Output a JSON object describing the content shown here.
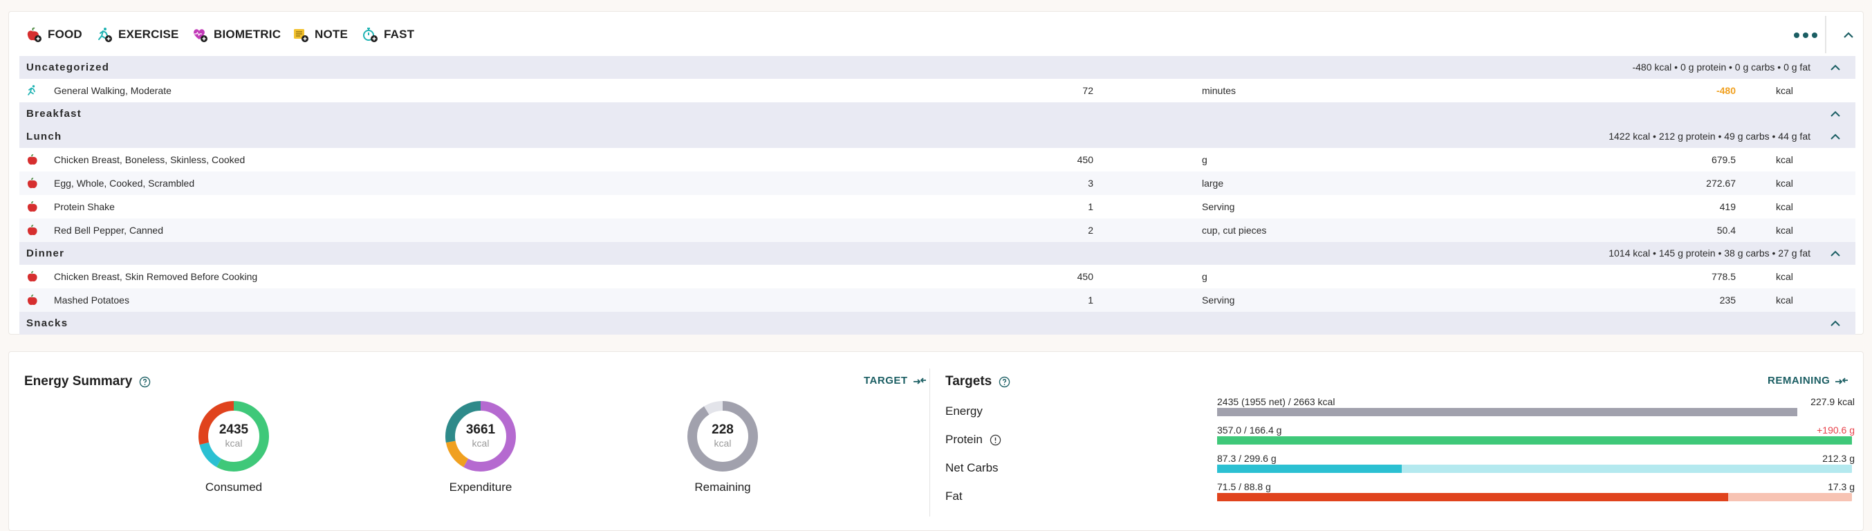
{
  "toolbar": {
    "buttons": [
      {
        "label": "FOOD",
        "icon": "apple-add-icon"
      },
      {
        "label": "EXERCISE",
        "icon": "runner-add-icon"
      },
      {
        "label": "BIOMETRIC",
        "icon": "heart-add-icon"
      },
      {
        "label": "NOTE",
        "icon": "note-add-icon"
      },
      {
        "label": "FAST",
        "icon": "stopwatch-add-icon"
      }
    ]
  },
  "diary": {
    "groups": [
      {
        "name": "Uncategorized",
        "summary": "-480 kcal • 0 g protein • 0 g carbs • 0 g fat",
        "items": [
          {
            "icon": "exercise-icon",
            "name": "General Walking, Moderate",
            "qty": "72",
            "unit": "minutes",
            "value": "-480",
            "value_unit": "kcal"
          }
        ]
      },
      {
        "name": "Breakfast",
        "summary": "",
        "items": []
      },
      {
        "name": "Lunch",
        "summary": "1422 kcal • 212 g protein • 49 g carbs • 44 g fat",
        "items": [
          {
            "icon": "food-icon",
            "name": "Chicken Breast, Boneless, Skinless, Cooked",
            "qty": "450",
            "unit": "g",
            "value": "679.5",
            "value_unit": "kcal"
          },
          {
            "icon": "food-icon",
            "name": "Egg, Whole, Cooked, Scrambled",
            "qty": "3",
            "unit": "large",
            "value": "272.67",
            "value_unit": "kcal"
          },
          {
            "icon": "food-icon",
            "name": "Protein Shake",
            "qty": "1",
            "unit": "Serving",
            "value": "419",
            "value_unit": "kcal"
          },
          {
            "icon": "food-icon",
            "name": "Red Bell Pepper, Canned",
            "qty": "2",
            "unit": "cup, cut pieces",
            "value": "50.4",
            "value_unit": "kcal"
          }
        ]
      },
      {
        "name": "Dinner",
        "summary": "1014 kcal • 145 g protein • 38 g carbs • 27 g fat",
        "items": [
          {
            "icon": "food-icon",
            "name": "Chicken Breast, Skin Removed Before Cooking",
            "qty": "450",
            "unit": "g",
            "value": "778.5",
            "value_unit": "kcal"
          },
          {
            "icon": "food-icon",
            "name": "Mashed Potatoes",
            "qty": "1",
            "unit": "Serving",
            "value": "235",
            "value_unit": "kcal"
          }
        ]
      },
      {
        "name": "Snacks",
        "summary": "",
        "items": []
      }
    ]
  },
  "energy_summary": {
    "title": "Energy Summary",
    "target_link": "TARGET",
    "rings": [
      {
        "value": "2435",
        "unit": "kcal",
        "label": "Consumed",
        "segments": [
          {
            "fraction": 0.58,
            "color": "#3fc879"
          },
          {
            "fraction": 0.13,
            "color": "#2bc0d2"
          },
          {
            "fraction": 0.29,
            "color": "#e0431d"
          }
        ]
      },
      {
        "value": "3661",
        "unit": "kcal",
        "label": "Expenditure",
        "segments": [
          {
            "fraction": 0.58,
            "color": "#b56ad0"
          },
          {
            "fraction": 0.14,
            "color": "#f0a020"
          },
          {
            "fraction": 0.28,
            "color": "#2e8a8a"
          }
        ]
      },
      {
        "value": "228",
        "unit": "kcal",
        "label": "Remaining",
        "segments": [
          {
            "fraction": 0.91,
            "color": "#a1a1ad"
          },
          {
            "fraction": 0.09,
            "color": "#e3e4ea"
          }
        ]
      }
    ]
  },
  "targets": {
    "title": "Targets",
    "remaining_link": "REMAINING",
    "items": [
      {
        "label": "Energy",
        "has_info": false,
        "text": "2435 (1955 net) / 2663 kcal",
        "remaining": "227.9 kcal",
        "over": false,
        "progress": 0.914,
        "fill_color": "#a1a1ad",
        "track_color": "#ffffff"
      },
      {
        "label": "Protein",
        "has_info": true,
        "text": "357.0 / 166.4 g",
        "remaining": "+190.6 g",
        "over": true,
        "progress": 1.0,
        "fill_color": "#3fc879",
        "track_color": "#c9f1d8"
      },
      {
        "label": "Net Carbs",
        "has_info": false,
        "text": "87.3 / 299.6 g",
        "remaining": "212.3 g",
        "over": false,
        "progress": 0.291,
        "fill_color": "#2bc0d2",
        "track_color": "#b4e9ef"
      },
      {
        "label": "Fat",
        "has_info": false,
        "text": "71.5 / 88.8 g",
        "remaining": "17.3 g",
        "over": false,
        "progress": 0.805,
        "fill_color": "#e0431d",
        "track_color": "#f7c3b3"
      }
    ]
  }
}
